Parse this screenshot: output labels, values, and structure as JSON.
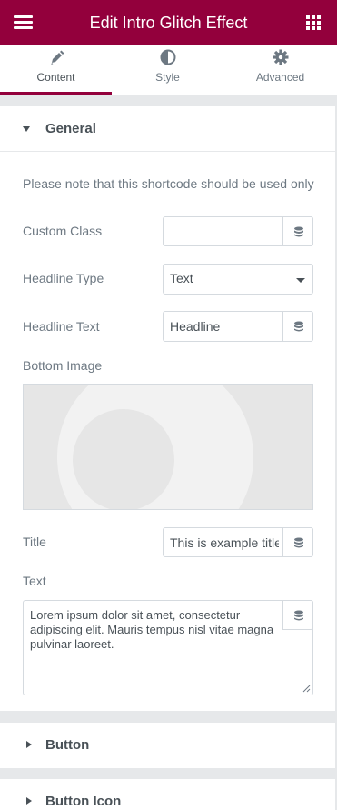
{
  "header": {
    "title": "Edit Intro Glitch Effect",
    "menu_icon": "hamburger-menu-icon",
    "apps_icon": "apps-grid-icon",
    "color": "#93003c"
  },
  "tabs": [
    {
      "label": "Content",
      "icon": "pencil-icon",
      "active": true
    },
    {
      "label": "Style",
      "icon": "half-circle-icon",
      "active": false
    },
    {
      "label": "Advanced",
      "icon": "gear-icon",
      "active": false
    }
  ],
  "general": {
    "title": "General",
    "note": "Please note that this shortcode should be used only",
    "custom_class_label": "Custom Class",
    "custom_class_value": "",
    "headline_type_label": "Headline Type",
    "headline_type_value": "Text",
    "headline_text_label": "Headline Text",
    "headline_text_value": "Headline",
    "bottom_image_label": "Bottom Image",
    "title_label": "Title",
    "title_value": "This is example title",
    "text_label": "Text",
    "text_value": "Lorem ipsum dolor sit amet, consectetur adipiscing elit. Mauris tempus nisl vitae magna pulvinar laoreet."
  },
  "sections": [
    {
      "title": "Button"
    },
    {
      "title": "Button Icon"
    }
  ]
}
